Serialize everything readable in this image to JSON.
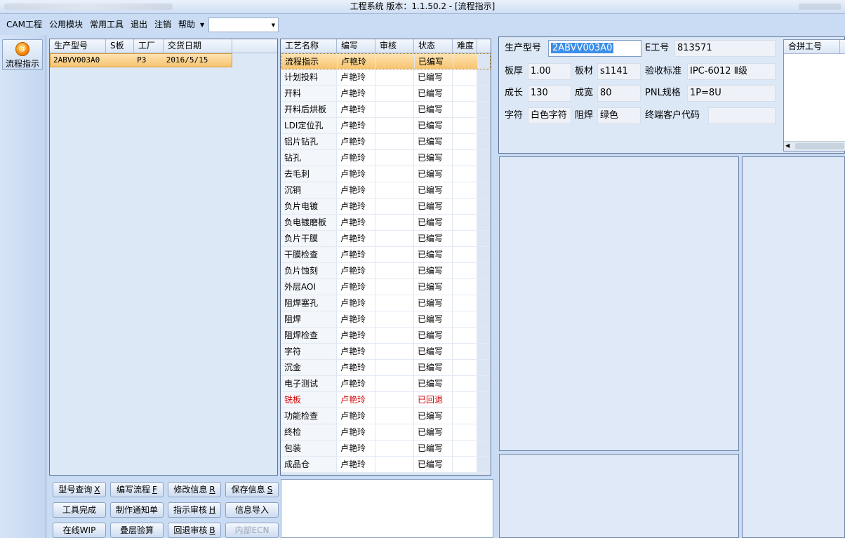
{
  "window": {
    "title": "工程系统   版本：1.1.50.2 - [流程指示]"
  },
  "menu": {
    "items": [
      "CAM工程",
      "公用模块",
      "常用工具",
      "退出",
      "注销",
      "帮助"
    ],
    "combo_value": ""
  },
  "toolbar": {
    "flow_label": "流程指示",
    "flow_icon": "flow-icon"
  },
  "products": {
    "headers": [
      "生产型号",
      "S板",
      "工厂",
      "交货日期"
    ],
    "rows": [
      {
        "model": "2ABVV003A0",
        "sboard": "",
        "factory": "P3",
        "date": "2016/5/15"
      }
    ]
  },
  "process": {
    "headers": [
      "工艺名称",
      "编写",
      "审核",
      "状态",
      "难度"
    ],
    "rows": [
      {
        "name": "流程指示",
        "writer": "卢艳玲",
        "reviewer": "",
        "status": "已编写",
        "difficulty": ""
      },
      {
        "name": "计划投料",
        "writer": "卢艳玲",
        "reviewer": "",
        "status": "已编写",
        "difficulty": ""
      },
      {
        "name": "开料",
        "writer": "卢艳玲",
        "reviewer": "",
        "status": "已编写",
        "difficulty": ""
      },
      {
        "name": "开料后烘板",
        "writer": "卢艳玲",
        "reviewer": "",
        "status": "已编写",
        "difficulty": ""
      },
      {
        "name": "LDI定位孔",
        "writer": "卢艳玲",
        "reviewer": "",
        "status": "已编写",
        "difficulty": ""
      },
      {
        "name": "铝片钻孔",
        "writer": "卢艳玲",
        "reviewer": "",
        "status": "已编写",
        "difficulty": ""
      },
      {
        "name": "钻孔",
        "writer": "卢艳玲",
        "reviewer": "",
        "status": "已编写",
        "difficulty": ""
      },
      {
        "name": "去毛刺",
        "writer": "卢艳玲",
        "reviewer": "",
        "status": "已编写",
        "difficulty": ""
      },
      {
        "name": "沉铜",
        "writer": "卢艳玲",
        "reviewer": "",
        "status": "已编写",
        "difficulty": ""
      },
      {
        "name": "负片电镀",
        "writer": "卢艳玲",
        "reviewer": "",
        "status": "已编写",
        "difficulty": ""
      },
      {
        "name": "负电镀磨板",
        "writer": "卢艳玲",
        "reviewer": "",
        "status": "已编写",
        "difficulty": ""
      },
      {
        "name": "负片干膜",
        "writer": "卢艳玲",
        "reviewer": "",
        "status": "已编写",
        "difficulty": ""
      },
      {
        "name": "干膜检查",
        "writer": "卢艳玲",
        "reviewer": "",
        "status": "已编写",
        "difficulty": ""
      },
      {
        "name": "负片蚀刻",
        "writer": "卢艳玲",
        "reviewer": "",
        "status": "已编写",
        "difficulty": ""
      },
      {
        "name": "外层AOI",
        "writer": "卢艳玲",
        "reviewer": "",
        "status": "已编写",
        "difficulty": ""
      },
      {
        "name": "阻焊塞孔",
        "writer": "卢艳玲",
        "reviewer": "",
        "status": "已编写",
        "difficulty": ""
      },
      {
        "name": "阻焊",
        "writer": "卢艳玲",
        "reviewer": "",
        "status": "已编写",
        "difficulty": ""
      },
      {
        "name": "阻焊检查",
        "writer": "卢艳玲",
        "reviewer": "",
        "status": "已编写",
        "difficulty": ""
      },
      {
        "name": "字符",
        "writer": "卢艳玲",
        "reviewer": "",
        "status": "已编写",
        "difficulty": ""
      },
      {
        "name": "沉金",
        "writer": "卢艳玲",
        "reviewer": "",
        "status": "已编写",
        "difficulty": ""
      },
      {
        "name": "电子测试",
        "writer": "卢艳玲",
        "reviewer": "",
        "status": "已编写",
        "difficulty": ""
      },
      {
        "name": "铣板",
        "writer": "卢艳玲",
        "reviewer": "",
        "status": "已回退",
        "difficulty": ""
      },
      {
        "name": "功能检查",
        "writer": "卢艳玲",
        "reviewer": "",
        "status": "已编写",
        "difficulty": ""
      },
      {
        "name": "终检",
        "writer": "卢艳玲",
        "reviewer": "",
        "status": "已编写",
        "difficulty": ""
      },
      {
        "name": "包装",
        "writer": "卢艳玲",
        "reviewer": "",
        "status": "已编写",
        "difficulty": ""
      },
      {
        "name": "成品仓",
        "writer": "卢艳玲",
        "reviewer": "",
        "status": "已编写",
        "difficulty": ""
      }
    ],
    "status_colors": {
      "normal": "#000000",
      "returned": "#d40000"
    }
  },
  "buttons": [
    {
      "id": "query-model",
      "label": "型号查询",
      "key": "X",
      "disabled": false
    },
    {
      "id": "write-flow",
      "label": "编写流程",
      "key": "F",
      "disabled": false
    },
    {
      "id": "modify-info",
      "label": "修改信息",
      "key": "R",
      "disabled": false
    },
    {
      "id": "save-info",
      "label": "保存信息",
      "key": "S",
      "disabled": false
    },
    {
      "id": "tool-done",
      "label": "工具完成",
      "key": "",
      "disabled": false
    },
    {
      "id": "make-notice",
      "label": "制作通知单",
      "key": "",
      "disabled": false
    },
    {
      "id": "review-instr",
      "label": "指示审核",
      "key": "H",
      "disabled": false
    },
    {
      "id": "import-info",
      "label": "信息导入",
      "key": "",
      "disabled": false
    },
    {
      "id": "online-wip",
      "label": "在线WIP",
      "key": "",
      "disabled": false
    },
    {
      "id": "stack-check",
      "label": "叠层验算",
      "key": "",
      "disabled": false
    },
    {
      "id": "return-review",
      "label": "回退审核",
      "key": "B",
      "disabled": false
    },
    {
      "id": "internal-ecn",
      "label": "内部ECN",
      "key": "",
      "disabled": true
    }
  ],
  "info": {
    "model_label": "生产型号",
    "model_value": "2ABVV003A0",
    "e_label": "E工号",
    "e_value": "813571",
    "thickness_label": "板厚",
    "thickness_value": "1.00",
    "material_label": "板材",
    "material_value": "s1141",
    "standard_label": "验收标准",
    "standard_value": "IPC-6012 Ⅱ级",
    "length_label": "成长",
    "length_value": "130",
    "width_label": "成宽",
    "width_value": "80",
    "pnl_label": "PNL规格",
    "pnl_value": "1P=8U",
    "char_label": "字符",
    "char_value": "白色字符",
    "mask_label": "阻焊",
    "mask_value": "绿色",
    "client_label": "终端客户代码",
    "client_value": ""
  },
  "merge": {
    "header": "合拼工号"
  }
}
